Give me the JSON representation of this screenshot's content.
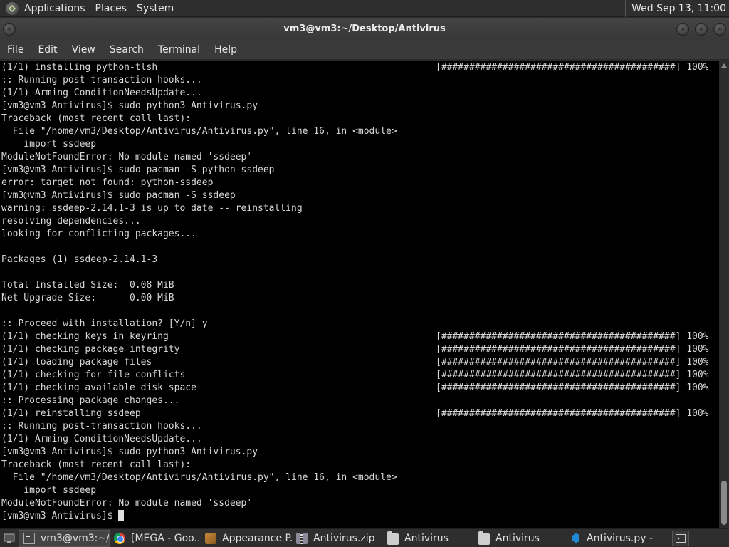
{
  "top_panel": {
    "menus": [
      "Applications",
      "Places",
      "System"
    ],
    "clock": "Wed Sep 13, 11:00"
  },
  "window": {
    "title": "vm3@vm3:~/Desktop/Antivirus"
  },
  "menubar": [
    "File",
    "Edit",
    "View",
    "Search",
    "Terminal",
    "Help"
  ],
  "terminal": {
    "lines": [
      {
        "text": "(1/1) installing python-tlsh",
        "progress": "[##########################################] 100%"
      },
      {
        "text": ":: Running post-transaction hooks...",
        "progress": ""
      },
      {
        "text": "(1/1) Arming ConditionNeedsUpdate...",
        "progress": ""
      },
      {
        "text": "[vm3@vm3 Antivirus]$ sudo python3 Antivirus.py",
        "progress": ""
      },
      {
        "text": "Traceback (most recent call last):",
        "progress": ""
      },
      {
        "text": "  File \"/home/vm3/Desktop/Antivirus/Antivirus.py\", line 16, in <module>",
        "progress": ""
      },
      {
        "text": "    import ssdeep",
        "progress": ""
      },
      {
        "text": "ModuleNotFoundError: No module named 'ssdeep'",
        "progress": ""
      },
      {
        "text": "[vm3@vm3 Antivirus]$ sudo pacman -S python-ssdeep",
        "progress": ""
      },
      {
        "text": "error: target not found: python-ssdeep",
        "progress": ""
      },
      {
        "text": "[vm3@vm3 Antivirus]$ sudo pacman -S ssdeep",
        "progress": ""
      },
      {
        "text": "warning: ssdeep-2.14.1-3 is up to date -- reinstalling",
        "progress": ""
      },
      {
        "text": "resolving dependencies...",
        "progress": ""
      },
      {
        "text": "looking for conflicting packages...",
        "progress": ""
      },
      {
        "text": "",
        "progress": ""
      },
      {
        "text": "Packages (1) ssdeep-2.14.1-3",
        "progress": ""
      },
      {
        "text": "",
        "progress": ""
      },
      {
        "text": "Total Installed Size:  0.08 MiB",
        "progress": ""
      },
      {
        "text": "Net Upgrade Size:      0.00 MiB",
        "progress": ""
      },
      {
        "text": "",
        "progress": ""
      },
      {
        "text": ":: Proceed with installation? [Y/n] y",
        "progress": ""
      },
      {
        "text": "(1/1) checking keys in keyring",
        "progress": "[##########################################] 100%"
      },
      {
        "text": "(1/1) checking package integrity",
        "progress": "[##########################################] 100%"
      },
      {
        "text": "(1/1) loading package files",
        "progress": "[##########################################] 100%"
      },
      {
        "text": "(1/1) checking for file conflicts",
        "progress": "[##########################################] 100%"
      },
      {
        "text": "(1/1) checking available disk space",
        "progress": "[##########################################] 100%"
      },
      {
        "text": ":: Processing package changes...",
        "progress": ""
      },
      {
        "text": "(1/1) reinstalling ssdeep",
        "progress": "[##########################################] 100%"
      },
      {
        "text": ":: Running post-transaction hooks...",
        "progress": ""
      },
      {
        "text": "(1/1) Arming ConditionNeedsUpdate...",
        "progress": ""
      },
      {
        "text": "[vm3@vm3 Antivirus]$ sudo python3 Antivirus.py",
        "progress": ""
      },
      {
        "text": "Traceback (most recent call last):",
        "progress": ""
      },
      {
        "text": "  File \"/home/vm3/Desktop/Antivirus/Antivirus.py\", line 16, in <module>",
        "progress": ""
      },
      {
        "text": "    import ssdeep",
        "progress": ""
      },
      {
        "text": "ModuleNotFoundError: No module named 'ssdeep'",
        "progress": ""
      }
    ],
    "prompt": "[vm3@vm3 Antivirus]$ "
  },
  "taskbar": {
    "tasks": [
      {
        "label": "vm3@vm3:~/...",
        "icon": "terminal-icon",
        "width": 128,
        "active": true
      },
      {
        "label": "[MEGA - Goo...",
        "icon": "chrome-icon",
        "width": 128,
        "active": false
      },
      {
        "label": "Appearance P...",
        "icon": "appearance-icon",
        "width": 128,
        "active": false
      },
      {
        "label": "Antivirus.zip",
        "icon": "archive-icon",
        "width": 128,
        "active": false
      },
      {
        "label": "Antivirus",
        "icon": "folder-icon",
        "width": 128,
        "active": false
      },
      {
        "label": "Antivirus",
        "icon": "folder-icon",
        "width": 128,
        "active": false
      },
      {
        "label": "Antivirus.py - ...",
        "icon": "vscode-icon",
        "width": 128,
        "active": false
      }
    ]
  }
}
